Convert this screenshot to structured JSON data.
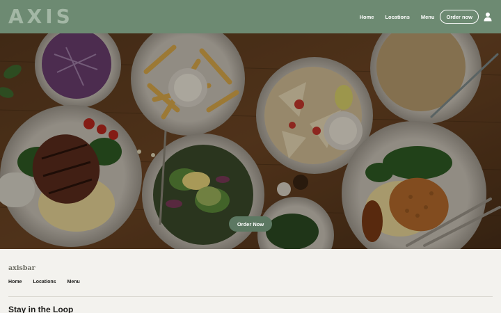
{
  "header": {
    "logo": "AXIS",
    "nav": [
      {
        "label": "Home"
      },
      {
        "label": "Locations"
      },
      {
        "label": "Menu"
      }
    ],
    "order_button": "Order now",
    "account_icon": "user-icon",
    "background_color": "#6d8a72"
  },
  "hero": {
    "image_description_icon": "food-spread-image",
    "cta_label": "Order Now",
    "cta_color": "#5c7862"
  },
  "footer": {
    "brand": "axisbar",
    "nav": [
      {
        "label": "Home"
      },
      {
        "label": "Locations"
      },
      {
        "label": "Menu"
      }
    ],
    "newsletter_title": "Stay in the Loop"
  }
}
